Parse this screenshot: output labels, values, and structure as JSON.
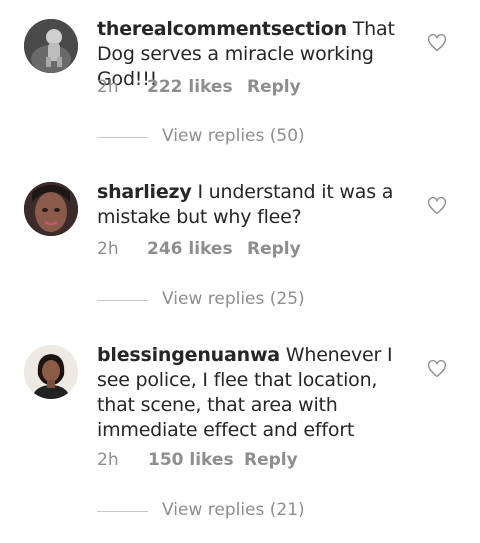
{
  "comments": [
    {
      "username": "therealcommentsection",
      "text": "That Dog serves a miracle working God!!!",
      "time": "2h",
      "likes": "222 likes",
      "reply_label": "Reply",
      "view_replies": "View replies (50)",
      "avatar_icon": "dog-statue-avatar"
    },
    {
      "username": "sharliezy",
      "text": "I understand it was a mistake but why flee?",
      "time": "2h",
      "likes": "246 likes",
      "reply_label": "Reply",
      "view_replies": "View replies (25)",
      "avatar_icon": "selfie-avatar"
    },
    {
      "username": "blessingenuanwa",
      "text": "Whenever I see police, I flee that location, that scene, that area with immediate effect and effort",
      "time": "2h",
      "likes": "150 likes",
      "reply_label": "Reply",
      "view_replies": "View replies (21)",
      "avatar_icon": "woman-avatar"
    }
  ],
  "icons": {
    "like": "heart-outline-icon"
  },
  "colors": {
    "text": "#262626",
    "meta": "#8e8e8e",
    "divider": "#c7c7c7"
  }
}
